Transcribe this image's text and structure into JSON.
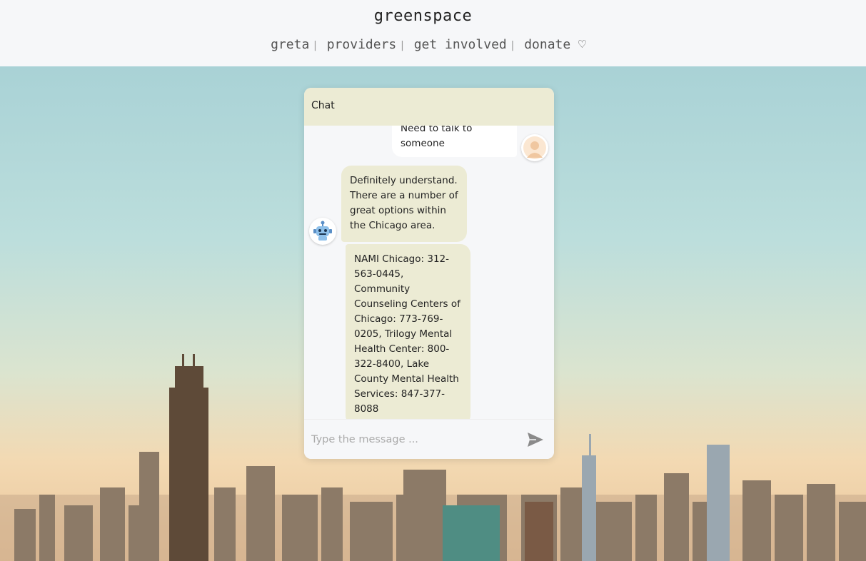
{
  "header": {
    "brand": "greenspace",
    "nav": [
      {
        "label": "greta"
      },
      {
        "label": "providers"
      },
      {
        "label": "get involved"
      },
      {
        "label": "donate ♡"
      }
    ]
  },
  "chat": {
    "title": "Chat",
    "messages": [
      {
        "from": "user",
        "text": "Need to talk to someone"
      },
      {
        "from": "bot",
        "text": "Definitely understand. There are a number of great options within the Chicago area."
      },
      {
        "from": "bot",
        "text": "NAMI Chicago: 312-563-0445, Community Counseling Centers of Chicago: 773-769-0205, Trilogy Mental Health Center: 800-322-8400, Lake County Mental Health Services: 847-377-8088"
      }
    ],
    "input_placeholder": "Type the message ...",
    "input_value": ""
  },
  "colors": {
    "chat_header": "#ecebd4",
    "bot_bubble": "#ecebd4",
    "user_bubble": "#ffffff",
    "send_icon": "#8a8a8a"
  },
  "icons": {
    "user_avatar": "person-avatar-icon",
    "bot_avatar": "robot-icon",
    "send": "send-arrow-icon"
  }
}
